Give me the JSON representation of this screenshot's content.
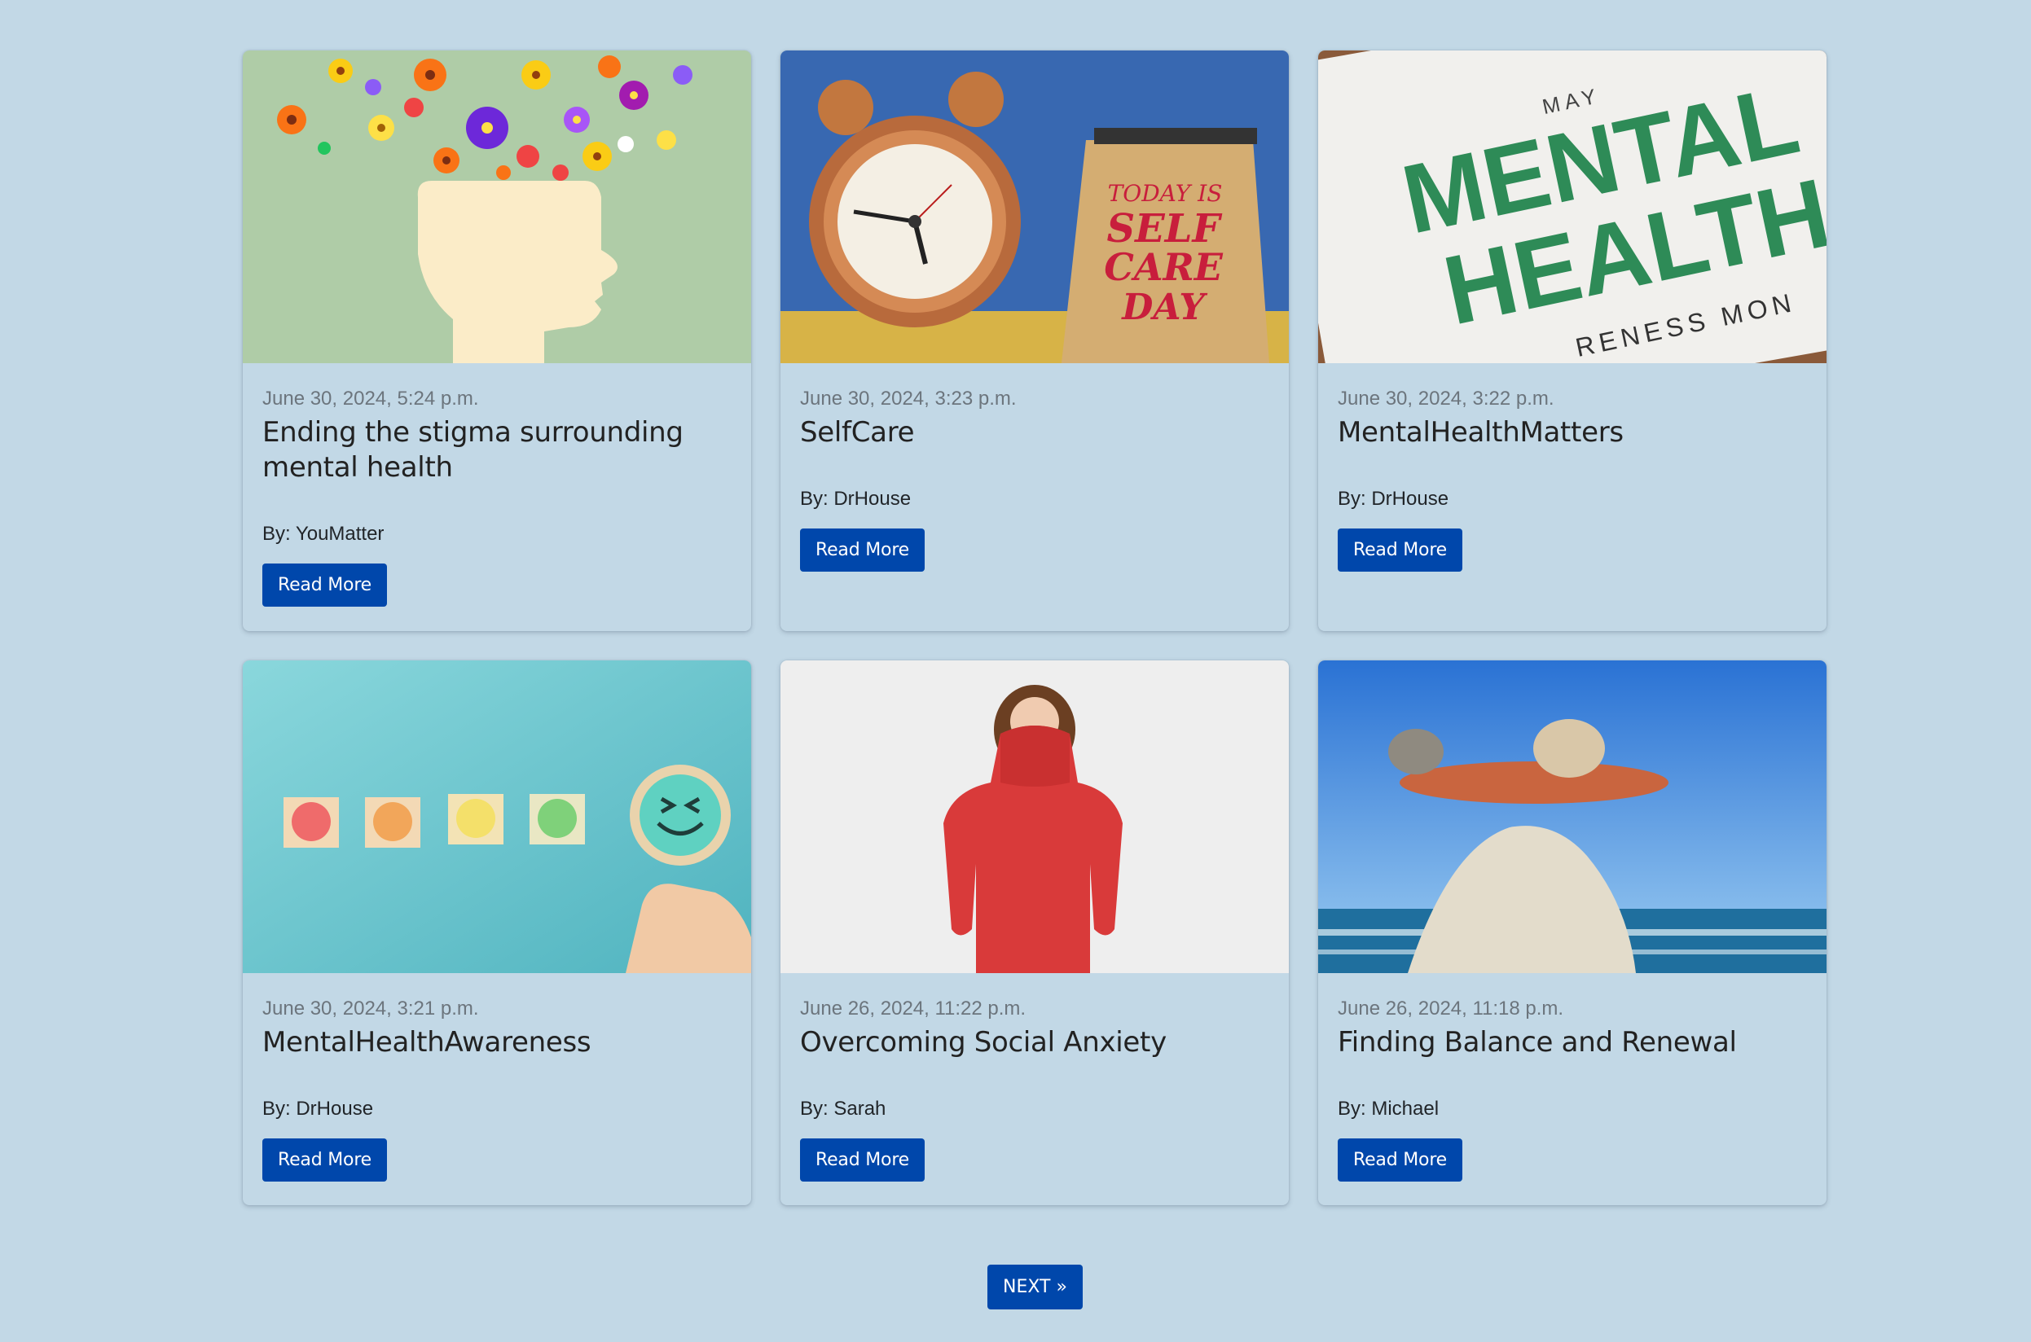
{
  "posts": [
    {
      "date": "June 30, 2024, 5:24 p.m.",
      "title": "Ending the stigma surrounding mental health",
      "author": "By: YouMatter",
      "button": "Read More",
      "image": "head-with-flowers"
    },
    {
      "date": "June 30, 2024, 3:23 p.m.",
      "title": "SelfCare",
      "author": "By: DrHouse",
      "button": "Read More",
      "image": "alarm-clock-and-calendar",
      "calendar_text": [
        "TODAY IS",
        "SELF",
        "CARE",
        "DAY"
      ]
    },
    {
      "date": "June 30, 2024, 3:22 p.m.",
      "title": "MentalHealthMatters",
      "author": "By: DrHouse",
      "button": "Read More",
      "image": "mental-health-month-card",
      "card_text": [
        "MAY",
        "MENTAL",
        "HEALTH",
        "RENESS MON"
      ]
    },
    {
      "date": "June 30, 2024, 3:21 p.m.",
      "title": "MentalHealthAwareness",
      "author": "By: DrHouse",
      "button": "Read More",
      "image": "emoji-blocks"
    },
    {
      "date": "June 26, 2024, 11:22 p.m.",
      "title": "Overcoming Social Anxiety",
      "author": "By: Sarah",
      "button": "Read More",
      "image": "woman-hiding-in-sweater"
    },
    {
      "date": "June 26, 2024, 11:18 p.m.",
      "title": "Finding Balance and Renewal",
      "author": "By: Michael",
      "button": "Read More",
      "image": "balanced-stones"
    }
  ],
  "pagination": {
    "next_label": "NEXT »"
  },
  "colors": {
    "background": "#c2d8e6",
    "button": "#0047ab",
    "date": "#6c757d"
  }
}
